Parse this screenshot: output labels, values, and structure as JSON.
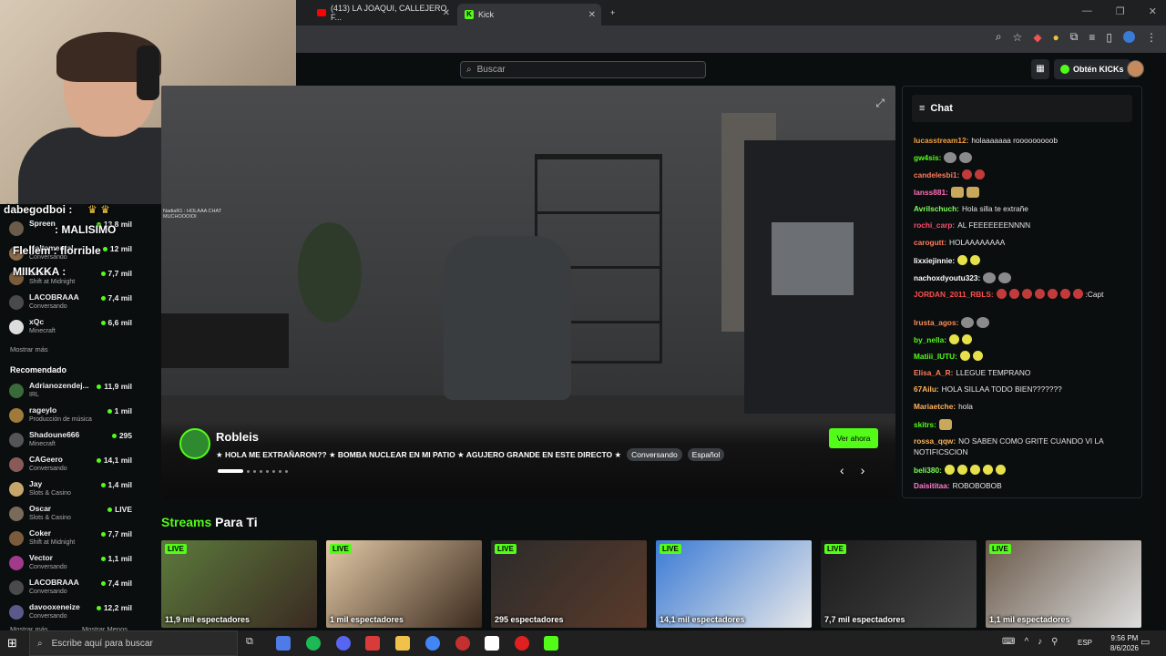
{
  "browser": {
    "tabs": [
      {
        "label": "(413) LA JOAQUI, CALLEJERO F..."
      },
      {
        "label": "Kick"
      }
    ],
    "new_tab_label": "+"
  },
  "header": {
    "search_placeholder": "Buscar",
    "get_kicks_label": "Obtén KICKs"
  },
  "webcam_overlay_chat": [
    {
      "text": "dabegodboi :"
    },
    {
      "text": "Spreen"
    },
    {
      "text": ": MALISIMO"
    },
    {
      "text": "Flellem : florrible"
    },
    {
      "text": "MIIKKKA :"
    }
  ],
  "sidebar": {
    "following": [
      {
        "name": "Spreen",
        "category": "",
        "viewers": "13,8 mil"
      },
      {
        "name": "Holtamental",
        "category": "Conversando",
        "viewers": "12 mil"
      },
      {
        "name": "Coker",
        "category": "Shift at Midnight",
        "viewers": "7,7 mil"
      },
      {
        "name": "LACOBRAAA",
        "category": "Conversando",
        "viewers": "7,4 mil"
      },
      {
        "name": "xQc",
        "category": "Minecraft",
        "viewers": "6,6 mil"
      }
    ],
    "show_more": "Mostrar más",
    "recommended_title": "Recomendado",
    "recommended": [
      {
        "name": "Adrianozendej...",
        "category": "IRL",
        "viewers": "11,9 mil"
      },
      {
        "name": "rageylo",
        "category": "Producción de música",
        "viewers": "1 mil"
      },
      {
        "name": "Shadoune666",
        "category": "Minecraft",
        "viewers": "295"
      },
      {
        "name": "CAGeero",
        "category": "Conversando",
        "viewers": "14,1 mil"
      },
      {
        "name": "Jay",
        "category": "Slots & Casino",
        "viewers": "1,4 mil"
      },
      {
        "name": "Oscar",
        "category": "Slots & Casino",
        "viewers": "LIVE"
      },
      {
        "name": "Coker",
        "category": "Shift at Midnight",
        "viewers": "7,7 mil"
      },
      {
        "name": "Vector",
        "category": "Conversando",
        "viewers": "1,1 mil"
      },
      {
        "name": "LACOBRAAA",
        "category": "Conversando",
        "viewers": "7,4 mil"
      },
      {
        "name": "davooxeneize",
        "category": "Conversando",
        "viewers": "12,2 mil"
      }
    ],
    "bottom_show_more": "Mostrar más",
    "bottom_show_less": "Mostrar Menos"
  },
  "hero": {
    "streamer": "Robleis",
    "title": "★ HOLA ME EXTRAÑARON?? ★ BOMBA NUCLEAR EN MI PATIO ★ AGUJERO GRANDE EN ESTE DIRECTO ★",
    "tags": [
      "Conversando",
      "Español"
    ],
    "cta": "Ver ahora",
    "mini_chat": [
      "NadiaR1 : HOLAAA CHAT",
      "MUCHOOOIOI"
    ]
  },
  "chat": {
    "title": "Chat",
    "messages": [
      {
        "user": "lucasstream12",
        "color": "#f0a040",
        "text": "holaaaaaaa rooooooooob"
      },
      {
        "user": "gw4sis",
        "color": "#53fc18",
        "text": ""
      },
      {
        "user": "candelesbi1",
        "color": "#ff7b5c",
        "text": ""
      },
      {
        "user": "lanss881",
        "color": "#ff6fb5",
        "text": ""
      },
      {
        "user": "Avrilschuch",
        "color": "#7fff5c",
        "text": "Hola silla te extrañe"
      },
      {
        "user": "rochi_carp",
        "color": "#ff4d6d",
        "text": "AL FEEEEEEENNNN"
      },
      {
        "user": "carogutt",
        "color": "#ff7b5c",
        "text": "HOLAAAAAAAA"
      },
      {
        "user": "lixxiejinnie",
        "color": "#ffffff",
        "text": ""
      },
      {
        "user": "nachoxdyoutu323",
        "color": "#ffffff",
        "text": ""
      },
      {
        "user": "JORDAN_2011_RBLS",
        "color": "#ff4d4d",
        "text": ":Capt"
      },
      {
        "user": "lrusta_agos",
        "color": "#ff8c5c",
        "text": ""
      },
      {
        "user": "by_nella",
        "color": "#53fc18",
        "text": ""
      },
      {
        "user": "Matiii_IUTU",
        "color": "#53fc18",
        "text": ""
      },
      {
        "user": "Elisa_A_R",
        "color": "#ff7b5c",
        "text": "LLEGUE TEMPRANO"
      },
      {
        "user": "67Ailu",
        "color": "#ffb35c",
        "text": "HOLA SILLAA TODO BIEN???????"
      },
      {
        "user": "Mariaetche",
        "color": "#ffb35c",
        "text": "hola"
      },
      {
        "user": "skitrs",
        "color": "#53fc18",
        "text": ""
      },
      {
        "user": "rossa_qqw",
        "color": "#ffb35c",
        "text": "NO SABEN COMO GRITE CUANDO VI LA"
      },
      {
        "user": "",
        "color": "#ffffff",
        "text": "NOTIFICSCION"
      },
      {
        "user": "beli380",
        "color": "#7fff5c",
        "text": ""
      },
      {
        "user": "Daisititaa",
        "color": "#ff7bd0",
        "text": "ROBOBOBOB"
      }
    ]
  },
  "streams_para_ti": {
    "title_green": "Streams",
    "title_white": "Para Ti",
    "live_label": "LIVE",
    "cards": [
      {
        "viewers": "11,9 mil espectadores",
        "live": true
      },
      {
        "viewers": "1 mil espectadores",
        "live": true
      },
      {
        "viewers": "295 espectadores",
        "live": true
      },
      {
        "viewers": "14,1 mil espectadores",
        "live": true
      },
      {
        "viewers": "7,7 mil espectadores",
        "live": true
      },
      {
        "viewers": "1,1 mil espectadores",
        "live": true
      }
    ]
  },
  "taskbar": {
    "search_placeholder": "Escribe aquí para buscar",
    "lang": "ESP",
    "time": "9:56 PM",
    "date": "8/6/2026"
  }
}
